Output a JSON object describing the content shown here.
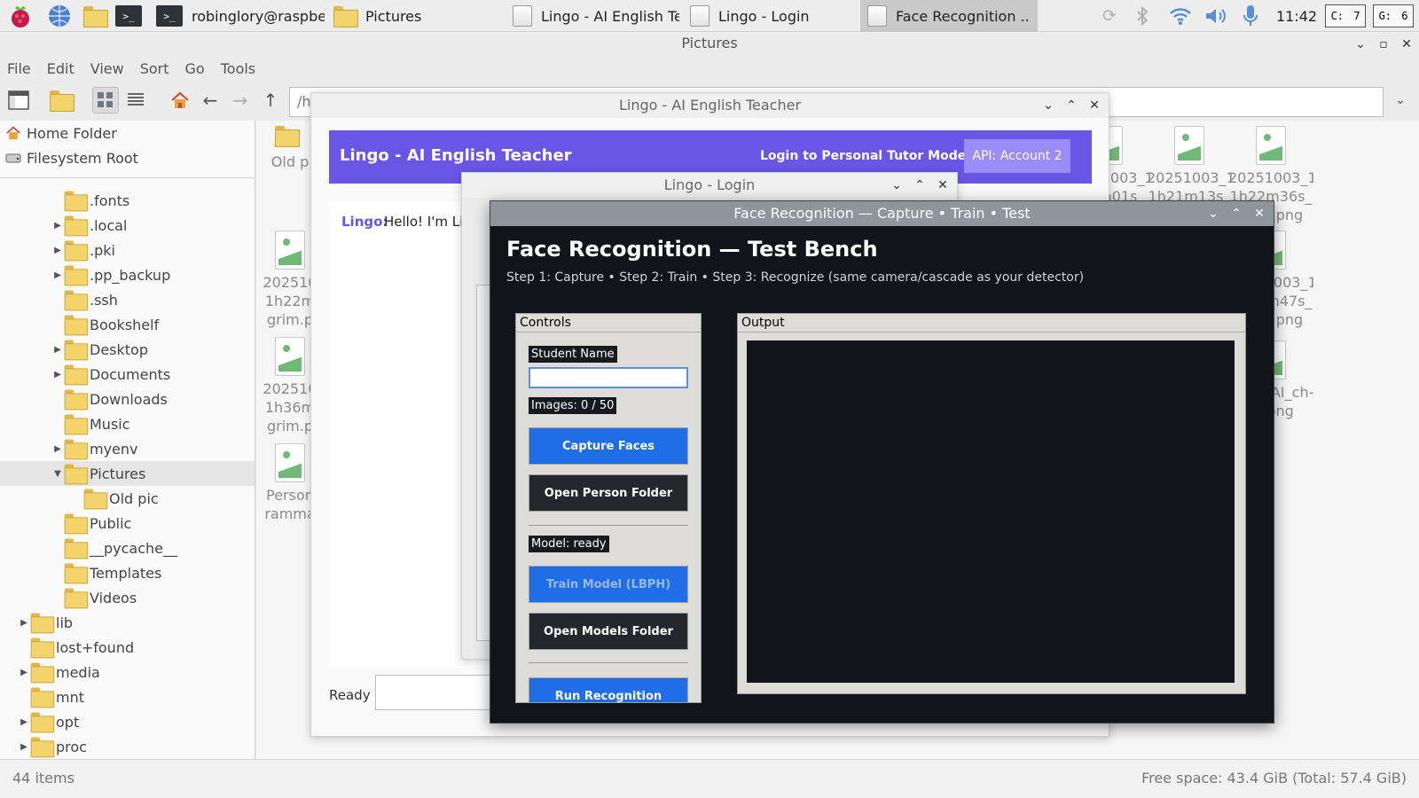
{
  "taskbar": {
    "tasks": [
      {
        "label": "robinglory@raspberr..",
        "icon": "terminal-icon"
      },
      {
        "label": "Pictures",
        "icon": "folder-icon"
      },
      {
        "label": "Lingo - AI English Te..",
        "icon": "window-icon"
      },
      {
        "label": "Lingo - Login",
        "icon": "window-icon"
      },
      {
        "label": "Face Recognition ..",
        "icon": "window-icon"
      }
    ],
    "clock": "11:42",
    "cpu_label": "C:",
    "cpu_value": "7",
    "gpu_label": "G:",
    "gpu_value": "6"
  },
  "file_manager": {
    "title": "Pictures",
    "menu": [
      "File",
      "Edit",
      "View",
      "Sort",
      "Go",
      "Tools"
    ],
    "path_value": "/h",
    "places": [
      "Home Folder",
      "Filesystem Root"
    ],
    "tree": [
      {
        "label": ".fonts",
        "expander": false
      },
      {
        "label": ".local",
        "expander": true
      },
      {
        "label": ".pki",
        "expander": true
      },
      {
        "label": ".pp_backup",
        "expander": true
      },
      {
        "label": ".ssh",
        "expander": false
      },
      {
        "label": "Bookshelf",
        "expander": false
      },
      {
        "label": "Desktop",
        "expander": true
      },
      {
        "label": "Documents",
        "expander": true
      },
      {
        "label": "Downloads",
        "expander": false
      },
      {
        "label": "Music",
        "expander": false
      },
      {
        "label": "myenv",
        "expander": true
      },
      {
        "label": "Pictures",
        "expander": true
      },
      {
        "label": "Old pic",
        "expander": false
      },
      {
        "label": "Public",
        "expander": false
      },
      {
        "label": "__pycache__",
        "expander": false
      },
      {
        "label": "Templates",
        "expander": false
      },
      {
        "label": "Videos",
        "expander": false
      },
      {
        "label": "lib",
        "expander": true
      },
      {
        "label": "lost+found",
        "expander": false
      },
      {
        "label": "media",
        "expander": true
      },
      {
        "label": "mnt",
        "expander": false
      },
      {
        "label": "opt",
        "expander": true
      },
      {
        "label": "proc",
        "expander": true
      }
    ],
    "files_left": [
      {
        "label": "Old p",
        "kind": "folder"
      },
      {
        "label": "202510\n1h22m\ngrim.p",
        "kind": "image"
      },
      {
        "label": "202510\n1h36m\ngrim.p",
        "kind": "image"
      },
      {
        "label": "Person\nramma",
        "kind": "image"
      }
    ],
    "files_right": [
      {
        "label": "20251003_1\nh21m01s_",
        "kind": "image"
      },
      {
        "label": "20251003_1\n1h21m13s_",
        "kind": "image"
      },
      {
        "label": "20251003_1\n1h22m36s_\ngrim.png",
        "kind": "image"
      },
      {
        "label": "20251003_1\n1h36m47s_\ngrim.png",
        "kind": "image"
      },
      {
        "label": "main_AI_ch-\nat.png",
        "kind": "image"
      }
    ],
    "status_items": "44 items",
    "status_free": "Free space: 43.4 GiB (Total: 57.4 GiB)"
  },
  "lingo": {
    "window_title": "Lingo - AI English Teacher",
    "header_title": "Lingo - AI English Teacher",
    "login_link": "Login to Personal Tutor Mode",
    "api_button": "API: Account 2",
    "chat_speaker": "Lingo:",
    "chat_text": "Hello! I'm Lin",
    "status": "Ready"
  },
  "login": {
    "window_title": "Lingo - Login"
  },
  "face": {
    "window_title": "Face Recognition — Capture • Train • Test",
    "title": "Face Recognition — Test Bench",
    "subtitle": "Step 1: Capture  •  Step 2: Train  •  Step 3: Recognize  (same camera/cascade as your detector)",
    "controls_label": "Controls",
    "student_name_label": "Student Name",
    "student_name_value": "",
    "images_label": "Images: 0 / 50",
    "capture_button": "Capture Faces",
    "open_person_button": "Open Person Folder",
    "model_label": "Model: ready",
    "train_button": "Train Model (LBPH)",
    "open_models_button": "Open Models Folder",
    "run_button": "Run Recognition",
    "output_label": "Output"
  },
  "colors": {
    "lingo_header": "#6a56e6",
    "lingo_api_button": "#9c8cf5",
    "lingo_speaker": "#6a56e6",
    "face_bg": "#111418",
    "face_blue_button": "#1f6ee8",
    "face_dark_button": "#24282d"
  }
}
